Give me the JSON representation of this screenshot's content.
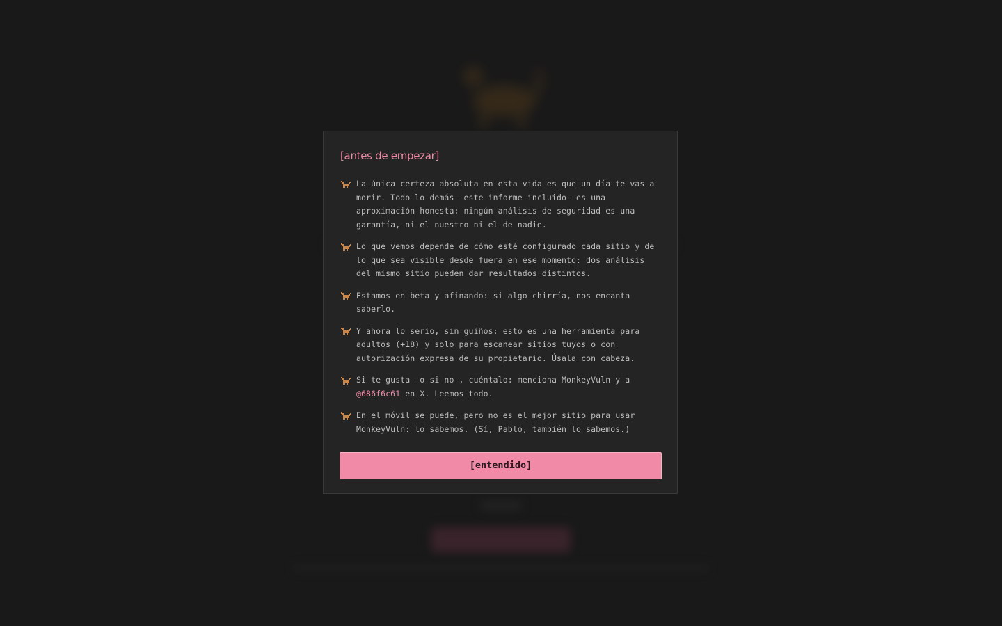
{
  "modal": {
    "title": "[antes de empezar]",
    "notes": [
      {
        "icon": "monkey-icon",
        "text": "La única certeza absoluta en esta vida es que un día te vas a morir. Todo lo demás —este informe incluido— es una aproximación honesta: ningún análisis de seguridad es una garantía, ni el nuestro ni el de nadie."
      },
      {
        "icon": "monkey-icon",
        "text": "Lo que vemos depende de cómo esté configurado cada sitio y de lo que sea visible desde fuera en ese momento: dos análisis del mismo sitio pueden dar resultados distintos."
      },
      {
        "icon": "monkey-icon",
        "text": "Estamos en beta y afinando: si algo chirría, nos encanta saberlo."
      },
      {
        "icon": "monkey-icon",
        "text": "Y ahora lo serio, sin guiños: esto es una herramienta para adultos (+18) y solo para escanear sitios tuyos o con autorización expresa de su propietario. Úsala con cabeza."
      },
      {
        "icon": "monkey-icon",
        "text_before": "Si te gusta —o si no—, cuéntalo: menciona MonkeyVuln y a ",
        "handle": "@686f6c61",
        "text_after": " en X. Leemos todo."
      },
      {
        "icon": "monkey-icon",
        "text": "En el móvil se puede, pero no es el mejor sitio para usar MonkeyVuln: lo sabemos. (Sí, Pablo, también lo sabemos.)"
      }
    ],
    "button_label": "[entendido]"
  },
  "colors": {
    "accent": "#f08aa6",
    "modal_bg": "#242424",
    "page_bg": "#1c1c1c",
    "text": "#bdbdbd",
    "icon": "#c8864a"
  }
}
